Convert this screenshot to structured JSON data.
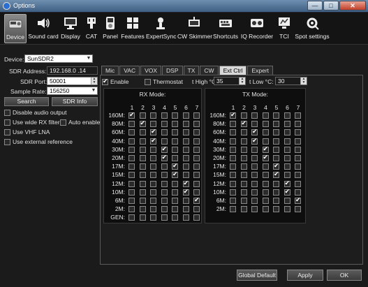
{
  "window": {
    "title": "Options",
    "min_glyph": "—",
    "max_glyph": "□",
    "close_glyph": "✕"
  },
  "toolbar": [
    {
      "label": "Device",
      "icon": "device-icon",
      "active": true
    },
    {
      "label": "Sound card",
      "icon": "speaker-icon"
    },
    {
      "label": "Display",
      "icon": "monitor-icon"
    },
    {
      "label": "CAT",
      "icon": "cat-icon"
    },
    {
      "label": "Panel",
      "icon": "panel-icon"
    },
    {
      "label": "Features",
      "icon": "features-icon"
    },
    {
      "label": "ExpertSync",
      "icon": "expertsync-icon"
    },
    {
      "label": "CW Skimmer",
      "icon": "cw-skimmer-icon"
    },
    {
      "label": "Shortcuts",
      "icon": "shortcuts-icon"
    },
    {
      "label": "IQ Recorder",
      "icon": "iq-recorder-icon"
    },
    {
      "label": "TCI",
      "icon": "tci-icon"
    },
    {
      "label": "Spot settings",
      "icon": "spot-settings-icon"
    }
  ],
  "device": {
    "device_label": "Device:",
    "device_value": "SunSDR2",
    "address_label": "SDR Address:",
    "address_value": "192.168.0 .14",
    "port_label": "SDR Port:",
    "port_value": "50001",
    "rate_label": "Sample Rate:",
    "rate_value": "156250",
    "search_label": "Search",
    "info_label": "SDR Info",
    "options": [
      {
        "label": "Disable audio output",
        "checked": false
      },
      {
        "label": "Use wide RX filter",
        "checked": false
      },
      {
        "label": "Auto enable",
        "checked": false
      },
      {
        "label": "Use VHF LNA",
        "checked": false
      },
      {
        "label": "Use external reference",
        "checked": false
      }
    ]
  },
  "tabs": [
    {
      "label": "Mic"
    },
    {
      "label": "VAC"
    },
    {
      "label": "VOX"
    },
    {
      "label": "DSP"
    },
    {
      "label": "TX"
    },
    {
      "label": "CW"
    },
    {
      "label": "Ext Ctrl",
      "active": true
    },
    {
      "label": "Expert"
    }
  ],
  "extctrl": {
    "enable_label": "Enable",
    "enable_checked": true,
    "thermostat_label": "Thermostat",
    "thermostat_checked": false,
    "thigh_label": "t High °C:",
    "thigh_value": "35",
    "tlow_label": "t Low °C:",
    "tlow_value": "30",
    "columns": [
      "1",
      "2",
      "3",
      "4",
      "5",
      "6",
      "7"
    ],
    "rx": {
      "title": "RX Mode:",
      "bands": [
        {
          "name": "160M:",
          "checks": [
            1
          ]
        },
        {
          "name": "80M:",
          "checks": [
            2
          ]
        },
        {
          "name": "60M:",
          "checks": [
            3
          ]
        },
        {
          "name": "40M:",
          "checks": [
            3
          ]
        },
        {
          "name": "30M:",
          "checks": [
            4
          ]
        },
        {
          "name": "20M:",
          "checks": [
            4
          ]
        },
        {
          "name": "17M:",
          "checks": [
            5
          ]
        },
        {
          "name": "15M:",
          "checks": [
            5
          ]
        },
        {
          "name": "12M:",
          "checks": [
            6
          ]
        },
        {
          "name": "10M:",
          "checks": [
            6
          ]
        },
        {
          "name": "6M:",
          "checks": [
            7
          ]
        },
        {
          "name": "2M:",
          "checks": []
        },
        {
          "name": "GEN:",
          "checks": []
        }
      ]
    },
    "tx": {
      "title": "TX Mode:",
      "bands": [
        {
          "name": "160M:",
          "checks": [
            1
          ]
        },
        {
          "name": "80M:",
          "checks": [
            2
          ]
        },
        {
          "name": "60M:",
          "checks": [
            3
          ]
        },
        {
          "name": "40M:",
          "checks": [
            3
          ]
        },
        {
          "name": "30M:",
          "checks": [
            4
          ]
        },
        {
          "name": "20M:",
          "checks": [
            4
          ]
        },
        {
          "name": "17M:",
          "checks": [
            5
          ]
        },
        {
          "name": "15M:",
          "checks": [
            5
          ]
        },
        {
          "name": "12M:",
          "checks": [
            6
          ]
        },
        {
          "name": "10M:",
          "checks": [
            6
          ]
        },
        {
          "name": "6M:",
          "checks": [
            7
          ]
        },
        {
          "name": "2M:",
          "checks": []
        }
      ]
    }
  },
  "footer": {
    "global_default_label": "Global Default",
    "apply_label": "Apply",
    "ok_label": "OK"
  }
}
